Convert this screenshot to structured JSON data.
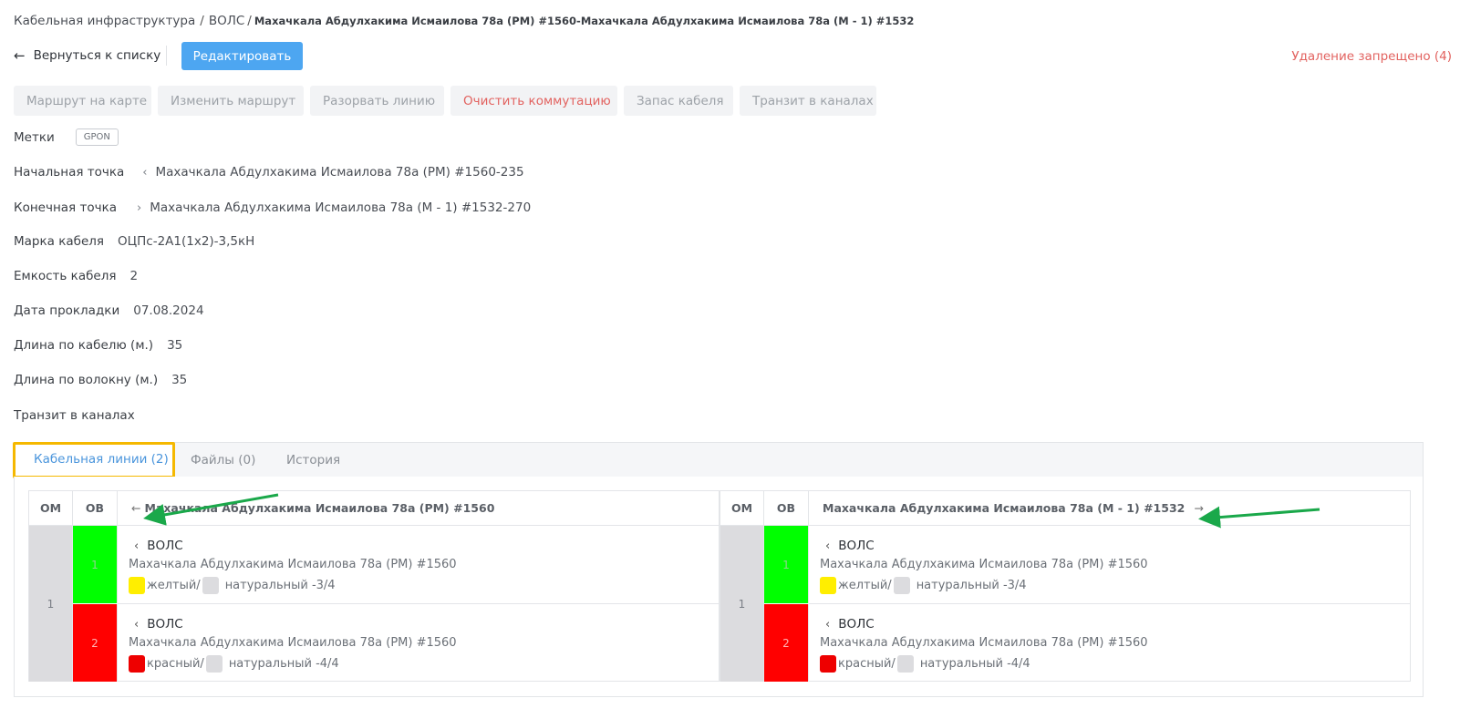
{
  "breadcrumb": {
    "root": "Кабельная инфраструктура",
    "section": "ВОЛС",
    "current": "Махачкала Абдулхакима Исмаилова 78а (РМ) #1560-Махачкала Абдулхакима Исмаилова 78а (М - 1) #1532"
  },
  "header": {
    "back_label": "Вернуться к списку",
    "edit_label": "Редактировать",
    "delete_forbidden": "Удаление запрещено (4)"
  },
  "actions": [
    {
      "label": "Маршрут на карте"
    },
    {
      "label": "Изменить маршрут"
    },
    {
      "label": "Разорвать линию"
    },
    {
      "label": "Очистить коммутацию"
    },
    {
      "label": "Запас кабеля"
    },
    {
      "label": "Транзит в каналах"
    }
  ],
  "details": {
    "tags_label": "Метки",
    "tag": "GPON",
    "start_label": "Начальная точка",
    "start_value": "Махачкала Абдулхакима Исмаилова 78а (РМ) #1560-235",
    "end_label": "Конечная точка",
    "end_value": "Махачкала Абдулхакима Исмаилова 78а (М - 1) #1532-270",
    "brand_label": "Марка кабеля",
    "brand_value": "ОЦПс-2А1(1х2)-3,5кН",
    "capacity_label": "Емкость кабеля",
    "capacity_value": "2",
    "date_label": "Дата прокладки",
    "date_value": "07.08.2024",
    "cable_len_label": "Длина по кабелю (м.)",
    "cable_len_value": "35",
    "fiber_len_label": "Длина по волокну (м.)",
    "fiber_len_value": "35",
    "transit_label": "Транзит в каналах"
  },
  "tabs": [
    {
      "label": "Кабельная линии (2)"
    },
    {
      "label": "Файлы (0)"
    },
    {
      "label": "История"
    }
  ],
  "panels": {
    "col_om": "ОМ",
    "col_ov": "ОВ",
    "left_title": "Махачкала Абдулхакима Исмаилова 78а (РМ) #1560",
    "right_title": "Махачкала Абдулхакима Исмаилова 78а (М - 1) #1532",
    "module": "1",
    "rows": [
      {
        "fiber": "1",
        "type": "ВОЛС",
        "location": "Махачкала Абдулхакима Исмаилова 78а (РМ) #1560",
        "color1": "желтый/",
        "color2": "натуральный -3/4"
      },
      {
        "fiber": "2",
        "type": "ВОЛС",
        "location": "Махачкала Абдулхакима Исмаилова 78а (РМ) #1560",
        "color1": "красный/",
        "color2": "натуральный -4/4"
      }
    ]
  },
  "colors": {
    "accent": "#4da6f1",
    "danger": "#e2625f",
    "fiber_green": "#00ff00",
    "fiber_red": "#ff0000",
    "swatch_yellow": "#ffee00",
    "swatch_red": "#ee0000",
    "swatch_natural": "#dcdcdf",
    "annotation_highlight": "#f5b800",
    "annotation_arrow": "#1aa84a"
  }
}
